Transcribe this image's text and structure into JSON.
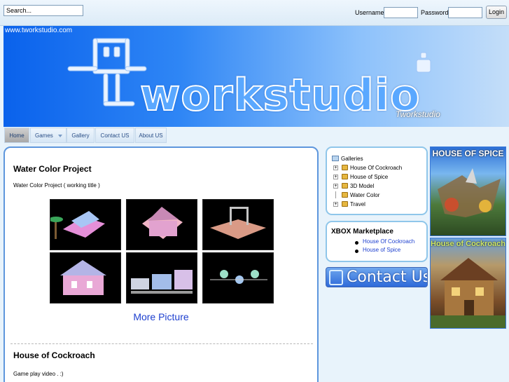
{
  "topbar": {
    "search_value": "Search...",
    "username_label": "Username",
    "password_label": "Password",
    "login_label": "Login"
  },
  "banner": {
    "url": "www.tworkstudio.com",
    "logo_text": "workstudio",
    "logo_sub": "Tworkstudio"
  },
  "nav": {
    "items": [
      {
        "label": "Home"
      },
      {
        "label": "Games"
      },
      {
        "label": "Gallery"
      },
      {
        "label": "Contact US"
      },
      {
        "label": "About US"
      }
    ]
  },
  "main": {
    "post1": {
      "title": "Water Color Project",
      "text": "Water Color Project ( working title )",
      "more_link": "More Picture"
    },
    "post2": {
      "title": "House of Cockroach",
      "text": "Game play video . :)"
    }
  },
  "galleries": {
    "title": "Galleries",
    "items": [
      {
        "label": "House Of Cockroach"
      },
      {
        "label": "House of Spice"
      },
      {
        "label": "3D Model"
      },
      {
        "label": "Water Color"
      },
      {
        "label": "Travel"
      }
    ]
  },
  "xbox": {
    "title": "XBOX Marketplace",
    "links": [
      {
        "label": "House Of Cockroach"
      },
      {
        "label": "House of Spice"
      }
    ]
  },
  "contact_banner": {
    "text": "Contact Us"
  },
  "ads": {
    "spice_title": "HOUSE OF SPICE",
    "cockroach_title": "House of Cockroach"
  },
  "colors": {
    "accent_blue": "#1d3fcf",
    "panel_border": "#5d96dd",
    "box_border": "#8fc6ea"
  }
}
